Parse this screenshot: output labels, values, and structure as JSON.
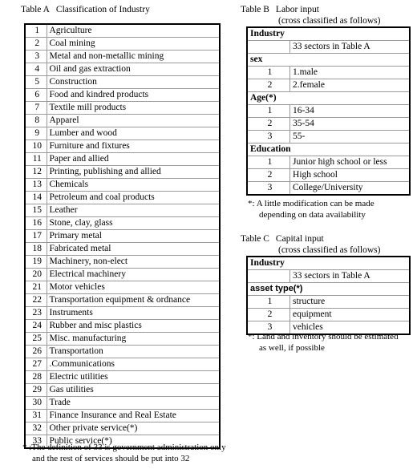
{
  "table_a": {
    "caption_label": "Table A",
    "caption_text": "Classification of Industry",
    "columns": [
      "",
      ""
    ],
    "rows": [
      {
        "num": "1",
        "name": "Agriculture"
      },
      {
        "num": "2",
        "name": "Coal mining"
      },
      {
        "num": "3",
        "name": "Metal and non-metallic mining"
      },
      {
        "num": "4",
        "name": "Oil and gas extraction"
      },
      {
        "num": "5",
        "name": "Construction"
      },
      {
        "num": "6",
        "name": "Food and kindred products"
      },
      {
        "num": "7",
        "name": "Textile mill products"
      },
      {
        "num": "8",
        "name": "Apparel"
      },
      {
        "num": "9",
        "name": "Lumber and wood"
      },
      {
        "num": "10",
        "name": "Furniture and fixtures"
      },
      {
        "num": "11",
        "name": "Paper and allied"
      },
      {
        "num": "12",
        "name": "Printing, publishing and allied"
      },
      {
        "num": "13",
        "name": "Chemicals"
      },
      {
        "num": "14",
        "name": "Petroleum and coal products"
      },
      {
        "num": "15",
        "name": "Leather"
      },
      {
        "num": "16",
        "name": "Stone, clay, glass"
      },
      {
        "num": "17",
        "name": "Primary metal"
      },
      {
        "num": "18",
        "name": "Fabricated metal"
      },
      {
        "num": "19",
        "name": "Machinery, non-elect"
      },
      {
        "num": "20",
        "name": "Electrical machinery"
      },
      {
        "num": "21",
        "name": "Motor vehicles"
      },
      {
        "num": "22",
        "name": "Transportation equipment & ordnance"
      },
      {
        "num": "23",
        "name": "Instruments"
      },
      {
        "num": "24",
        "name": "Rubber and misc plastics"
      },
      {
        "num": "25",
        "name": "Misc. manufacturing"
      },
      {
        "num": "26",
        "name": "Transportation"
      },
      {
        "num": "27",
        "name": ".Communications"
      },
      {
        "num": "28",
        "name": "Electric utilities"
      },
      {
        "num": "29",
        "name": "Gas utilities"
      },
      {
        "num": "30",
        "name": "Trade"
      },
      {
        "num": "31",
        "name": "Finance Insurance and Real Estate"
      },
      {
        "num": "32",
        "name": "Other private service(*)"
      },
      {
        "num": "33",
        "name": "Public service(*)"
      }
    ],
    "footnote_line1": "* :The definition of 33 is government administration only",
    "footnote_line2": "and the rest of services should be put into 32"
  },
  "table_b": {
    "caption_label": "Table B",
    "caption_text": "Labor input",
    "caption_sub": "(cross classified as follows)",
    "rows": [
      {
        "kind": "header",
        "style": "serif",
        "num": "",
        "name": "Industry"
      },
      {
        "kind": "data",
        "style": "serif",
        "num": "",
        "name": "33 sectors in Table A"
      },
      {
        "kind": "header",
        "style": "serif",
        "num": "",
        "name": "sex"
      },
      {
        "kind": "data",
        "style": "serif",
        "num": "1",
        "name": "1.male"
      },
      {
        "kind": "data",
        "style": "serif",
        "num": "2",
        "name": "2.female"
      },
      {
        "kind": "header",
        "style": "serif",
        "num": "",
        "name": "Age(*)"
      },
      {
        "kind": "data",
        "style": "serif",
        "num": "1",
        "name": "16-34"
      },
      {
        "kind": "data",
        "style": "serif",
        "num": "2",
        "name": "35-54"
      },
      {
        "kind": "data",
        "style": "serif",
        "num": "3",
        "name": "55-"
      },
      {
        "kind": "header",
        "style": "serif",
        "num": "",
        "name": "Education"
      },
      {
        "kind": "data",
        "style": "serif",
        "num": "1",
        "name": "Junior high school or less"
      },
      {
        "kind": "data",
        "style": "serif",
        "num": "2",
        "name": "High school"
      },
      {
        "kind": "data",
        "style": "serif",
        "num": "3",
        "name": "College/University"
      }
    ],
    "footnote_line1": "*: A little modification can be made",
    "footnote_line2": "depending on data availability"
  },
  "table_c": {
    "caption_label": "Table C",
    "caption_text": "Capital input",
    "caption_sub": "(cross classified as follows)",
    "rows": [
      {
        "kind": "header",
        "style": "serif",
        "num": "",
        "name": "Industry"
      },
      {
        "kind": "data",
        "style": "serif",
        "num": "",
        "name": "33 sectors in Table A"
      },
      {
        "kind": "header",
        "style": "sans",
        "num": "",
        "name": "asset type(*)"
      },
      {
        "kind": "data",
        "style": "serif",
        "num": "1",
        "name": "structure"
      },
      {
        "kind": "data",
        "style": "serif",
        "num": "2",
        "name": "equipment"
      },
      {
        "kind": "data",
        "style": "serif",
        "num": "3",
        "name": "vehicles"
      }
    ],
    "footnote_line1": "*: Land and inventory should be estimated",
    "footnote_line2": "as well, if possible"
  }
}
